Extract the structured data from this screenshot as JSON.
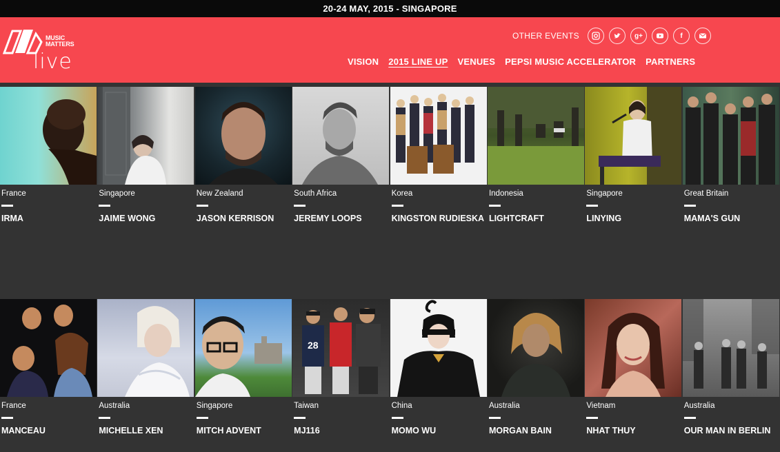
{
  "topbar": {
    "text": "20-24 MAY, 2015 - SINGAPORE"
  },
  "logo": {
    "line1": "MUSIC",
    "line2": "MATTERS",
    "line3": "live"
  },
  "header": {
    "other_events": "OTHER EVENTS",
    "socials": [
      "instagram-icon",
      "twitter-icon",
      "google-plus-icon",
      "youtube-icon",
      "facebook-icon",
      "email-icon"
    ]
  },
  "nav": [
    "VISION",
    "2015 LINE UP",
    "VENUES",
    "PEPSI MUSIC ACCELERATOR",
    "PARTNERS"
  ],
  "colors": {
    "brand": "#f7474f",
    "topbar": "#0a0a0a",
    "grid_bg": "#333333"
  },
  "artists_row1": [
    {
      "country": "France",
      "name": "IRMA"
    },
    {
      "country": "Singapore",
      "name": "JAIME WONG"
    },
    {
      "country": "New Zealand",
      "name": "JASON KERRISON"
    },
    {
      "country": "South Africa",
      "name": "JEREMY LOOPS"
    },
    {
      "country": "Korea",
      "name": "KINGSTON RUDIESKA"
    },
    {
      "country": "Indonesia",
      "name": "LIGHTCRAFT"
    },
    {
      "country": "Singapore",
      "name": "LINYING"
    },
    {
      "country": "Great Britain",
      "name": "MAMA'S GUN"
    }
  ],
  "artists_row2": [
    {
      "country": "France",
      "name": "MANCEAU"
    },
    {
      "country": "Australia",
      "name": "MICHELLE XEN"
    },
    {
      "country": "Singapore",
      "name": "MITCH ADVENT"
    },
    {
      "country": "Taiwan",
      "name": "MJ116"
    },
    {
      "country": "China",
      "name": "MOMO WU"
    },
    {
      "country": "Australia",
      "name": "MORGAN BAIN"
    },
    {
      "country": "Vietnam",
      "name": "NHAT THUY"
    },
    {
      "country": "Australia",
      "name": "OUR MAN IN BERLIN"
    }
  ]
}
